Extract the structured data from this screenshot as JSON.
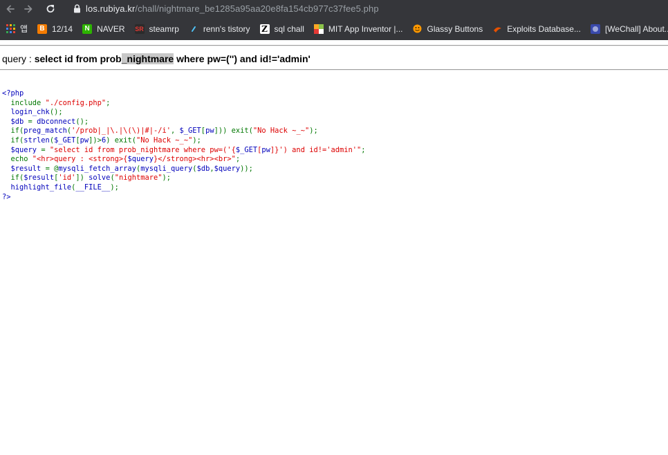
{
  "browser": {
    "url_host": "los.rubiya.kr",
    "url_path": "/chall/nightmare_be1285a95aa20e8fa154cb977c37fee5.php",
    "bookmarks": [
      {
        "label": "앱",
        "icon": "apps-grid-icon",
        "color": "#e8eaed"
      },
      {
        "label": "12/14",
        "icon": "blogger-icon",
        "color": "#f57c00"
      },
      {
        "label": "NAVER",
        "icon": "naver-icon",
        "color": "#2db400"
      },
      {
        "label": "steamrp",
        "icon": "steamrp-icon",
        "color": "#c62828"
      },
      {
        "label": "renn's tistory",
        "icon": "tistory-icon",
        "color": "#4fc3f7"
      },
      {
        "label": "sql chall",
        "icon": "z-icon",
        "color": "#ffffff"
      },
      {
        "label": "MIT App Inventor |...",
        "icon": "app-inventor-icon",
        "color": "#f9a825"
      },
      {
        "label": "Glassy Buttons",
        "icon": "glassy-buttons-icon",
        "color": "#ff9800"
      },
      {
        "label": "Exploits Database...",
        "icon": "exploit-db-icon",
        "color": "#e65100"
      },
      {
        "label": "[WeChall] About...",
        "icon": "wechall-icon",
        "color": "#3f51b5"
      }
    ]
  },
  "page": {
    "query_prefix": "query : ",
    "query_part1": "select id from prob",
    "query_highlight": "_nightmare",
    "query_part2": " where pw=('') and id!='admin'"
  },
  "source_code": {
    "lines": [
      [
        {
          "t": "<?php",
          "c": "def"
        }
      ],
      [
        {
          "t": "  include ",
          "c": "kw"
        },
        {
          "t": "\"./config.php\"",
          "c": "str"
        },
        {
          "t": ";",
          "c": "kw"
        }
      ],
      [
        {
          "t": "  login_chk",
          "c": "def"
        },
        {
          "t": "();",
          "c": "kw"
        }
      ],
      [
        {
          "t": "  $db ",
          "c": "def"
        },
        {
          "t": "= ",
          "c": "kw"
        },
        {
          "t": "dbconnect",
          "c": "def"
        },
        {
          "t": "();",
          "c": "kw"
        }
      ],
      [
        {
          "t": "  if(",
          "c": "kw"
        },
        {
          "t": "preg_match",
          "c": "def"
        },
        {
          "t": "(",
          "c": "kw"
        },
        {
          "t": "'/prob|_|\\.|\\(\\)|#|-/i'",
          "c": "str"
        },
        {
          "t": ", ",
          "c": "kw"
        },
        {
          "t": "$_GET",
          "c": "def"
        },
        {
          "t": "[",
          "c": "kw"
        },
        {
          "t": "pw",
          "c": "def"
        },
        {
          "t": "])) exit(",
          "c": "kw"
        },
        {
          "t": "\"No Hack ~_~\"",
          "c": "str"
        },
        {
          "t": ");",
          "c": "kw"
        }
      ],
      [
        {
          "t": "  if(",
          "c": "kw"
        },
        {
          "t": "strlen",
          "c": "def"
        },
        {
          "t": "(",
          "c": "kw"
        },
        {
          "t": "$_GET",
          "c": "def"
        },
        {
          "t": "[",
          "c": "kw"
        },
        {
          "t": "pw",
          "c": "def"
        },
        {
          "t": "])>",
          "c": "kw"
        },
        {
          "t": "6",
          "c": "def"
        },
        {
          "t": ") exit(",
          "c": "kw"
        },
        {
          "t": "\"No Hack ~_~\"",
          "c": "str"
        },
        {
          "t": ");",
          "c": "kw"
        }
      ],
      [
        {
          "t": "  $query ",
          "c": "def"
        },
        {
          "t": "= ",
          "c": "kw"
        },
        {
          "t": "\"select id from prob_nightmare where pw=('{",
          "c": "str"
        },
        {
          "t": "$_GET",
          "c": "def"
        },
        {
          "t": "[",
          "c": "str"
        },
        {
          "t": "pw",
          "c": "def"
        },
        {
          "t": "]",
          "c": "str"
        },
        {
          "t": "}') and id!='admin'\"",
          "c": "str"
        },
        {
          "t": ";",
          "c": "kw"
        }
      ],
      [
        {
          "t": "  echo ",
          "c": "kw"
        },
        {
          "t": "\"<hr>query : <strong>{",
          "c": "str"
        },
        {
          "t": "$query",
          "c": "def"
        },
        {
          "t": "}</strong><hr><br>\"",
          "c": "str"
        },
        {
          "t": ";",
          "c": "kw"
        }
      ],
      [
        {
          "t": "  $result ",
          "c": "def"
        },
        {
          "t": "= @",
          "c": "kw"
        },
        {
          "t": "mysqli_fetch_array",
          "c": "def"
        },
        {
          "t": "(",
          "c": "kw"
        },
        {
          "t": "mysqli_query",
          "c": "def"
        },
        {
          "t": "(",
          "c": "kw"
        },
        {
          "t": "$db",
          "c": "def"
        },
        {
          "t": ",",
          "c": "kw"
        },
        {
          "t": "$query",
          "c": "def"
        },
        {
          "t": "));",
          "c": "kw"
        }
      ],
      [
        {
          "t": "  if(",
          "c": "kw"
        },
        {
          "t": "$result",
          "c": "def"
        },
        {
          "t": "[",
          "c": "kw"
        },
        {
          "t": "'id'",
          "c": "str"
        },
        {
          "t": "]) ",
          "c": "kw"
        },
        {
          "t": "solve",
          "c": "def"
        },
        {
          "t": "(",
          "c": "kw"
        },
        {
          "t": "\"nightmare\"",
          "c": "str"
        },
        {
          "t": ");",
          "c": "kw"
        }
      ],
      [
        {
          "t": "  highlight_file",
          "c": "def"
        },
        {
          "t": "(",
          "c": "kw"
        },
        {
          "t": "__FILE__",
          "c": "def"
        },
        {
          "t": ");",
          "c": "kw"
        }
      ],
      [
        {
          "t": "?>",
          "c": "def"
        }
      ]
    ]
  }
}
